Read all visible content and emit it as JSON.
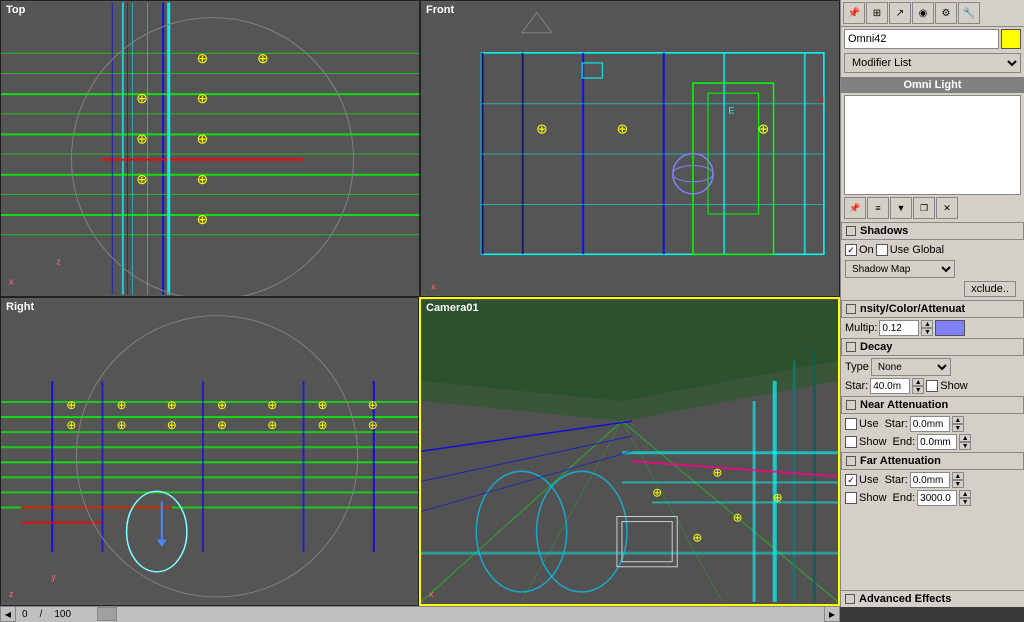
{
  "viewports": {
    "top": {
      "label": "Top"
    },
    "front": {
      "label": "Front"
    },
    "right": {
      "label": "Right"
    },
    "camera": {
      "label": "Camera01"
    }
  },
  "scrollbar": {
    "value": "0",
    "max": "100"
  },
  "right_panel": {
    "object_name": "Omni42",
    "color_swatch": "#ffff00",
    "modifier_list_label": "Modifier List",
    "omni_light_label": "Omni Light",
    "toolbar_icons": [
      "pin-icon",
      "move-icon",
      "rotate-icon",
      "scale-icon",
      "render-icon",
      "settings-icon"
    ],
    "stack_icons": [
      "pin2-icon",
      "bar-icon",
      "funnel-icon",
      "clipboard-icon",
      "x-icon"
    ],
    "shadows": {
      "label": "Shadows",
      "on_checked": true,
      "on_label": "On",
      "use_global_checked": false,
      "use_global_label": "Use Global",
      "shadow_map_label": "Shadow Map",
      "xclude_label": "xclude.."
    },
    "intensity": {
      "label": "nsity/Color/Attenuat",
      "multip_label": "Multip:",
      "multip_value": "0.12",
      "color_swatch": "#8080ff"
    },
    "decay": {
      "label": "Decay",
      "type_label": "Type",
      "type_value": "None",
      "start_label": "Star:",
      "start_value": "40.0m",
      "show_checked": false,
      "show_label": "Show"
    },
    "near_attenuation": {
      "label": "Near Attenuation",
      "use_checked": false,
      "use_label": "Use",
      "start_label": "Star:",
      "start_value": "0.0mm",
      "show_checked": false,
      "show_label": "Show",
      "end_label": "End:",
      "end_value": "0.0mm"
    },
    "far_attenuation": {
      "label": "Far Attenuation",
      "use_checked": true,
      "use_label": "Use",
      "start_label": "Star:",
      "start_value": "0.0mm",
      "show_checked": false,
      "show_label": "Show",
      "end_label": "End:",
      "end_value": "3000.0"
    },
    "advanced_effects_label": "Advanced Effects"
  }
}
